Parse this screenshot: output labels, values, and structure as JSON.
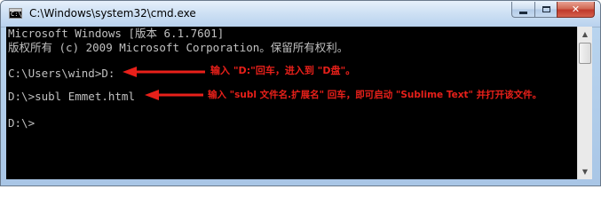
{
  "window": {
    "title": "C:\\Windows\\system32\\cmd.exe"
  },
  "console": {
    "lines": [
      "Microsoft Windows [版本 6.1.7601]",
      "版权所有 (c) 2009 Microsoft Corporation。保留所有权利。",
      "",
      "C:\\Users\\wind>D:",
      "",
      "D:\\>subl Emmet.html",
      "",
      "D:\\>"
    ]
  },
  "annotations": {
    "first": "输入 \"D:\"回车，进入到 \"D盘\"。",
    "second": "输入 \"subl 文件名.扩展名\" 回车，即可启动 \"Sublime Text\" 并打开该文件。"
  },
  "colors": {
    "console_bg": "#000000",
    "console_text": "#c0c0c0",
    "annotation": "#e8201a"
  },
  "icons": {
    "app": "cmd-icon",
    "minimize": "minimize-icon",
    "maximize": "maximize-icon",
    "close": "close-icon",
    "scroll_up": "arrow-up-icon",
    "scroll_down": "arrow-down-icon"
  }
}
